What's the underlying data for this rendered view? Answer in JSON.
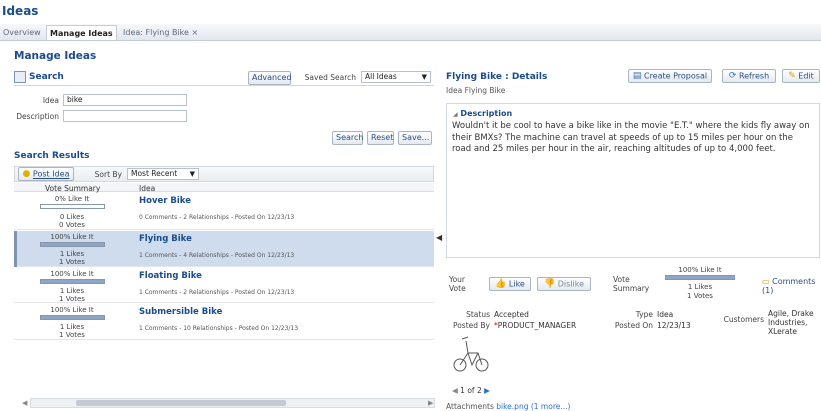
{
  "app": {
    "title": "Ideas"
  },
  "tabs": [
    {
      "label": "Overview"
    },
    {
      "label": "Manage Ideas"
    },
    {
      "label": "Idea: Flying Bike ×"
    }
  ],
  "manage": {
    "title": "Manage Ideas"
  },
  "search": {
    "title": "Search",
    "advanced": "Advanced",
    "saved_label": "Saved Search",
    "saved_value": "All Ideas",
    "idea_label": "Idea",
    "idea_value": "bike",
    "desc_label": "Description",
    "desc_value": "",
    "btn_search": "Search",
    "btn_reset": "Reset",
    "btn_save": "Save..."
  },
  "results": {
    "title": "Search Results",
    "post": "Post Idea",
    "sortby": "Sort By",
    "sort_value": "Most Recent",
    "col_vote": "Vote Summary",
    "col_idea": "Idea",
    "rows": [
      {
        "pct": "0% Like It",
        "fill": 0,
        "likes": "0 Likes",
        "votes": "0 Votes",
        "name": "Hover Bike",
        "meta": "0 Comments - 2 Relationships - Posted On 12/23/13"
      },
      {
        "pct": "100% Like It",
        "fill": 100,
        "likes": "1 Likes",
        "votes": "1 Votes",
        "name": "Flying Bike",
        "meta": "1 Comments - 4 Relationships - Posted On 12/23/13"
      },
      {
        "pct": "100% Like It",
        "fill": 100,
        "likes": "1 Likes",
        "votes": "1 Votes",
        "name": "Floating Bike",
        "meta": "1 Comments - 2 Relationships - Posted On 12/23/13"
      },
      {
        "pct": "100% Like It",
        "fill": 100,
        "likes": "1 Likes",
        "votes": "1 Votes",
        "name": "Submersible Bike",
        "meta": "1 Comments - 10 Relationships - Posted On 12/23/13"
      }
    ]
  },
  "details": {
    "title": "Flying Bike : Details",
    "idea_label": "Idea",
    "idea_value": "Flying Bike",
    "create": "Create Proposal",
    "refresh": "Refresh",
    "edit": "Edit",
    "desc_title": "Description",
    "desc_text": "Wouldn't it be cool to have a bike like in the movie \"E.T.\" where the kids fly away on their BMXs? The machine can travel at speeds of up to 15 miles per hour on the road and 25 miles per hour in the air, reaching altitudes of up to 4,000 feet.",
    "your_vote": "Your Vote",
    "like": "Like",
    "dislike": "Dislike",
    "vote_summary": "Vote Summary",
    "vs_pct": "100% Like It",
    "vs_likes": "1 Likes",
    "vs_votes": "1 Votes",
    "vs_fill": 100,
    "comments": "Comments (1)",
    "status_label": "Status",
    "status_value": "Accepted",
    "postedby_label": "Posted By",
    "postedby_value": "PRODUCT_MANAGER",
    "type_label": "Type",
    "type_value": "Idea",
    "postedon_label": "Posted On",
    "postedon_value": "12/23/13",
    "customers_label": "Customers",
    "customers_value": "Agile, Drake Industries, XLerate",
    "pager": "1 of 2",
    "attach_label": "Attachments",
    "attach_value": "bike.png (1 more...)"
  }
}
